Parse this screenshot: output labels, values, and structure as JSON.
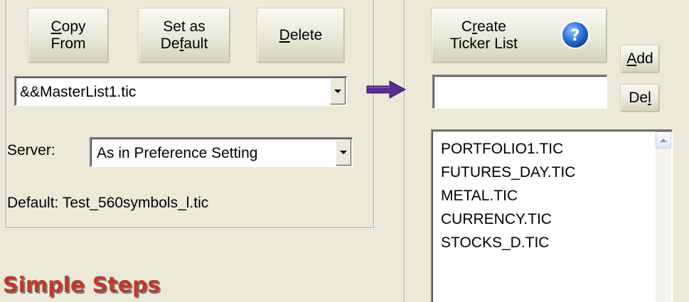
{
  "buttons": {
    "copy_from_line1": "Copy",
    "copy_from_line2": "From",
    "set_default_line1": "Set as",
    "set_default_line2": "Default",
    "delete": "Delete",
    "create_line1": "Create",
    "create_line2": "Ticker List",
    "add": "Add",
    "del": "Del"
  },
  "master_list_value": "&&MasterList1.tic",
  "server": {
    "label": "Server:",
    "value": "As in Preference Setting"
  },
  "default_line": "Default: Test_560symbols_l.tic",
  "new_ticker_input": "",
  "ticker_lists": [
    "PORTFOLIO1.TIC",
    "FUTURES_DAY.TIC",
    "METAL.TIC",
    "CURRENCY.TIC",
    "STOCKS_D.TIC"
  ],
  "heading": "Simple Steps",
  "icons": {
    "help": "help-icon",
    "arrow": "right-arrow-icon",
    "dropdown": "chevron-down-icon",
    "scroll_up": "scroll-up-icon"
  },
  "colors": {
    "background": "#ece9d8",
    "arrow": "#5a2d91",
    "heading": "#c0392b",
    "help_icon": "#2b6fd6"
  }
}
